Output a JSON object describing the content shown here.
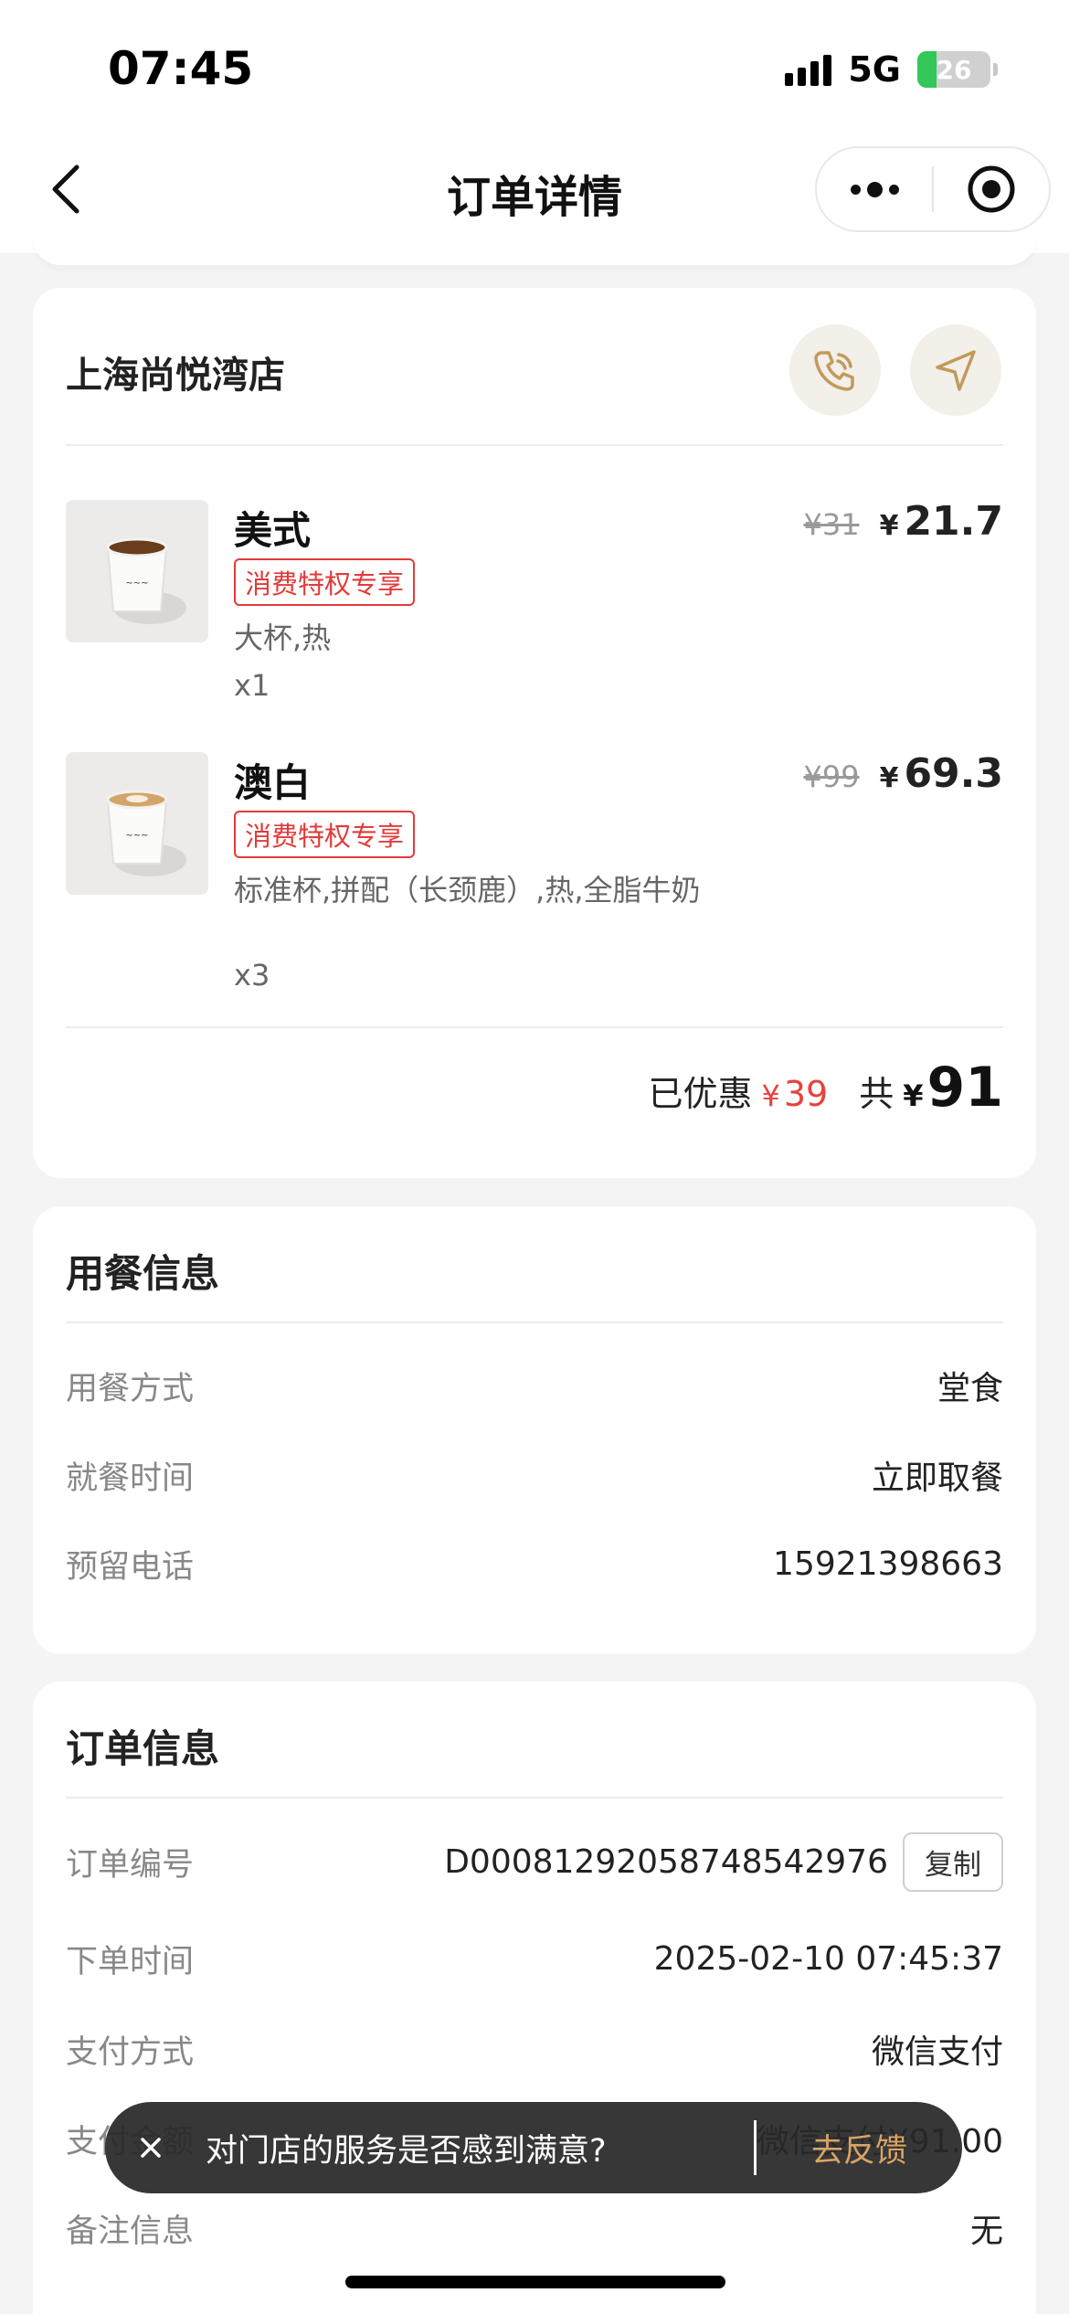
{
  "status_bar": {
    "time": "07:45",
    "network": "5G",
    "battery": "26",
    "battery_level_fraction": 0.26
  },
  "nav": {
    "title": "订单详情"
  },
  "store": {
    "name": "上海尚悦湾店",
    "items": [
      {
        "name": "美式",
        "tag": "消费特权专享",
        "spec": "大杯,热",
        "qty": "x1",
        "original_price": "¥31",
        "currency": "¥",
        "price": "21.7"
      },
      {
        "name": "澳白",
        "tag": "消费特权专享",
        "spec": "标准杯,拼配（长颈鹿）,热,全脂牛奶",
        "qty": "x3",
        "original_price": "¥99",
        "currency": "¥",
        "price": "69.3"
      }
    ],
    "summary": {
      "discount_label": "已优惠",
      "discount_currency": "¥",
      "discount_value": "39",
      "total_label": "共",
      "total_currency": "¥",
      "total_value": "91"
    }
  },
  "dine_info": {
    "title": "用餐信息",
    "rows": [
      {
        "label": "用餐方式",
        "value": "堂食"
      },
      {
        "label": "就餐时间",
        "value": "立即取餐"
      },
      {
        "label": "预留电话",
        "value": "15921398663"
      }
    ]
  },
  "order_info": {
    "title": "订单信息",
    "order_no_label": "订单编号",
    "order_no": "D0008129205874854297​6",
    "copy_label": "复制",
    "rows": [
      {
        "label": "下单时间",
        "value": "2025-02-10 07:45:37"
      },
      {
        "label": "支付方式",
        "value": "微信支付"
      },
      {
        "label": "支付金额",
        "value": "微信支付¥91.00"
      },
      {
        "label": "备注信息",
        "value": "无"
      }
    ]
  },
  "toast": {
    "message": "对门店的服务是否感到满意?",
    "action": "去反馈"
  },
  "colors": {
    "accent_red": "#e33a3a",
    "gold": "#c29a5c",
    "background": "#f4f4f4"
  }
}
